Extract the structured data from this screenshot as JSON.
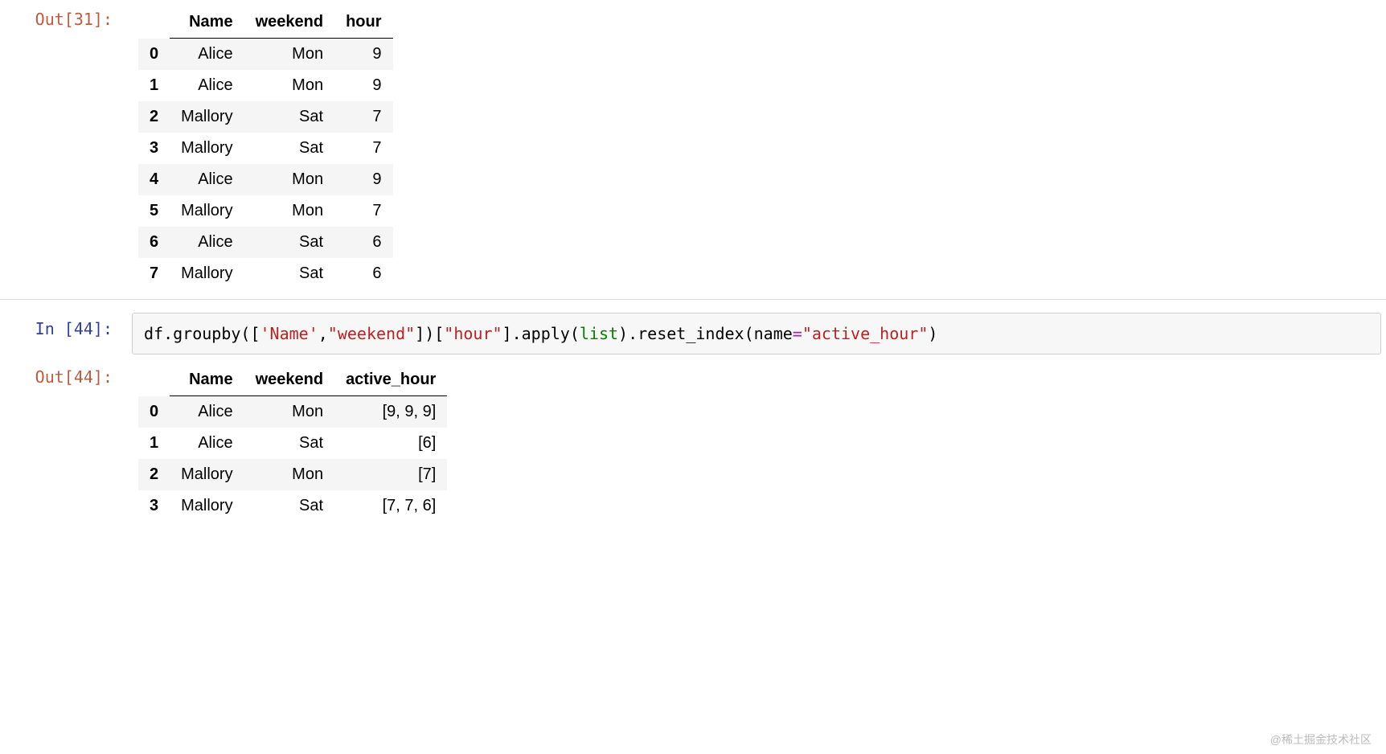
{
  "cells": {
    "out31": {
      "prompt": "Out[31]:",
      "table": {
        "columns": [
          "Name",
          "weekend",
          "hour"
        ],
        "rows": [
          {
            "idx": "0",
            "Name": "Alice",
            "weekend": "Mon",
            "hour": "9"
          },
          {
            "idx": "1",
            "Name": "Alice",
            "weekend": "Mon",
            "hour": "9"
          },
          {
            "idx": "2",
            "Name": "Mallory",
            "weekend": "Sat",
            "hour": "7"
          },
          {
            "idx": "3",
            "Name": "Mallory",
            "weekend": "Sat",
            "hour": "7"
          },
          {
            "idx": "4",
            "Name": "Alice",
            "weekend": "Mon",
            "hour": "9"
          },
          {
            "idx": "5",
            "Name": "Mallory",
            "weekend": "Mon",
            "hour": "7"
          },
          {
            "idx": "6",
            "Name": "Alice",
            "weekend": "Sat",
            "hour": "6"
          },
          {
            "idx": "7",
            "Name": "Mallory",
            "weekend": "Sat",
            "hour": "6"
          }
        ]
      }
    },
    "in44": {
      "prompt": "In [44]:",
      "code_tokens": [
        {
          "t": "df.groupby(["
        },
        {
          "t": "'Name'",
          "c": "tok-str"
        },
        {
          "t": ","
        },
        {
          "t": "\"weekend\"",
          "c": "tok-str"
        },
        {
          "t": "])["
        },
        {
          "t": "\"hour\"",
          "c": "tok-str"
        },
        {
          "t": "].apply("
        },
        {
          "t": "list",
          "c": "tok-func"
        },
        {
          "t": ").reset_index(name"
        },
        {
          "t": "=",
          "c": "tok-op"
        },
        {
          "t": "\"active_hour\"",
          "c": "tok-str"
        },
        {
          "t": ")"
        }
      ]
    },
    "out44": {
      "prompt": "Out[44]:",
      "table": {
        "columns": [
          "Name",
          "weekend",
          "active_hour"
        ],
        "rows": [
          {
            "idx": "0",
            "Name": "Alice",
            "weekend": "Mon",
            "active_hour": "[9, 9, 9]"
          },
          {
            "idx": "1",
            "Name": "Alice",
            "weekend": "Sat",
            "active_hour": "[6]"
          },
          {
            "idx": "2",
            "Name": "Mallory",
            "weekend": "Mon",
            "active_hour": "[7]"
          },
          {
            "idx": "3",
            "Name": "Mallory",
            "weekend": "Sat",
            "active_hour": "[7, 7, 6]"
          }
        ]
      }
    }
  },
  "watermark": "@稀土掘金技术社区"
}
